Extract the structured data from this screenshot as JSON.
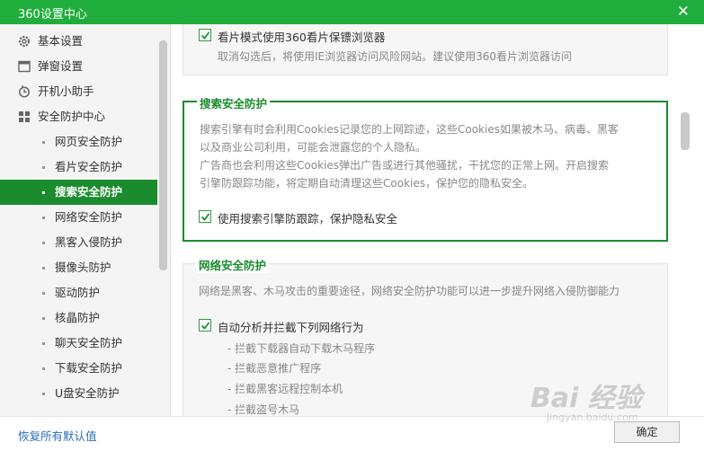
{
  "window": {
    "title": "360设置中心"
  },
  "sidebar": {
    "items": [
      {
        "label": "基本设置",
        "icon": "gear-icon"
      },
      {
        "label": "弹窗设置",
        "icon": "window-icon"
      },
      {
        "label": "开机小助手",
        "icon": "clock-icon"
      },
      {
        "label": "安全防护中心",
        "icon": "grid-icon"
      }
    ],
    "sub_items": [
      "网页安全防护",
      "看片安全防护",
      "搜索安全防护",
      "网络安全防护",
      "黑客入侵防护",
      "摄像头防护",
      "驱动防护",
      "核晶防护",
      "聊天安全防护",
      "下载安全防护",
      "U盘安全防护"
    ],
    "active": "搜索安全防护"
  },
  "sections": {
    "movie": {
      "checkbox_label": "看片模式使用360看片保镖浏览器",
      "checked": true,
      "desc": "取消勾选后，将使用IE浏览器访问风险网站。建议使用360看片浏览器访问"
    },
    "search": {
      "title": "搜索安全防护",
      "desc_lines": [
        "搜索引擎有时会利用Cookies记录您的上网踪迹，这些Cookies如果被木马、病毒、黑客",
        "以及商业公司利用，可能会泄露您的个人隐私。",
        "广告商也会利用这些Cookies弹出广告或进行其他骚扰，干扰您的正常上网。开启搜索",
        "引擎防跟踪功能，将定期自动清理这些Cookies，保护您的隐私安全。"
      ],
      "checkbox_label": "使用搜索引擎防跟踪，保护隐私安全",
      "checked": true
    },
    "network": {
      "title": "网络安全防护",
      "desc": "网络是黑客、木马攻击的重要途径，网络安全防护功能可以进一步提升网络入侵防御能力",
      "checkbox_label": "自动分析并拦截下列网络行为",
      "checked": true,
      "bullets": [
        "- 拦截下载器自动下载木马程序",
        "- 拦截恶意推广程序",
        "- 拦截黑客远程控制本机",
        "- 拦截盗号木马"
      ]
    }
  },
  "footer": {
    "restore_label": "恢复所有默认值",
    "confirm_label": "确定"
  },
  "watermark": {
    "text": "Bai 经验",
    "url_text": "jingyan.baidu.com"
  },
  "colors": {
    "accent": "#1fae3b",
    "active": "#1a8c2d",
    "link": "#2a6fb5"
  }
}
